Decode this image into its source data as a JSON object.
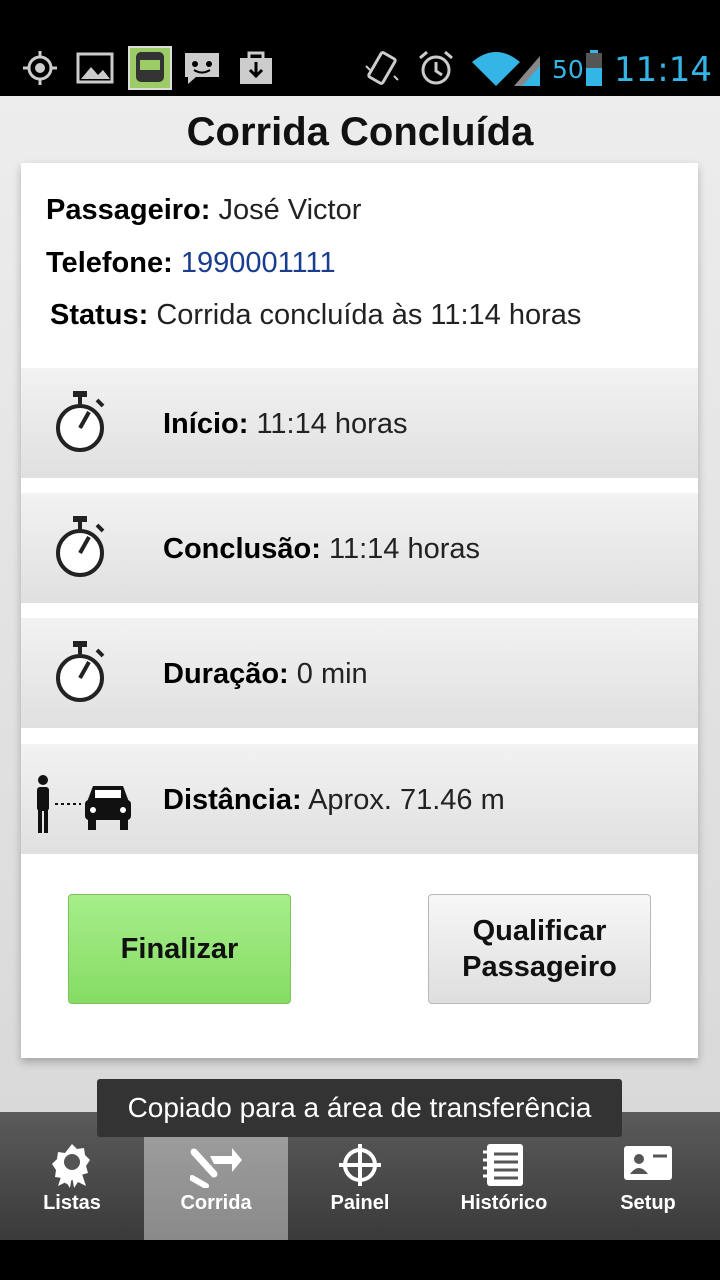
{
  "status_bar": {
    "battery": "50",
    "time": "11:14"
  },
  "title": "Corrida Concluída",
  "info": {
    "passenger_label": "Passageiro:",
    "passenger_value": "José Victor",
    "phone_label": "Telefone:",
    "phone_value": "1990001111",
    "status_label": "Status:",
    "status_value": "Corrida concluída às 11:14 horas"
  },
  "rows": [
    {
      "label": "Início:",
      "value": "11:14 horas",
      "icon": "stopwatch-icon"
    },
    {
      "label": "Conclusão:",
      "value": "11:14 horas",
      "icon": "stopwatch-icon"
    },
    {
      "label": "Duração:",
      "value": "0 min",
      "icon": "stopwatch-icon"
    },
    {
      "label": "Distância:",
      "value": "Aprox. 71.46 m",
      "icon": "person-to-car-icon"
    }
  ],
  "buttons": {
    "finalize": "Finalizar",
    "rate_line1": "Qualificar",
    "rate_line2": "Passageiro"
  },
  "toast": "Copiado para a área de transferência",
  "tabs": [
    {
      "label": "Listas",
      "icon": "badge-icon"
    },
    {
      "label": "Corrida",
      "icon": "hand-arrow-icon",
      "active": true
    },
    {
      "label": "Painel",
      "icon": "crosshair-icon"
    },
    {
      "label": "Histórico",
      "icon": "notebook-icon"
    },
    {
      "label": "Setup",
      "icon": "contact-card-icon"
    }
  ],
  "colors": {
    "finalize_button": "#86dc64",
    "phone_link": "#1a3d8f",
    "status_bar_accent": "#33b5e5"
  }
}
